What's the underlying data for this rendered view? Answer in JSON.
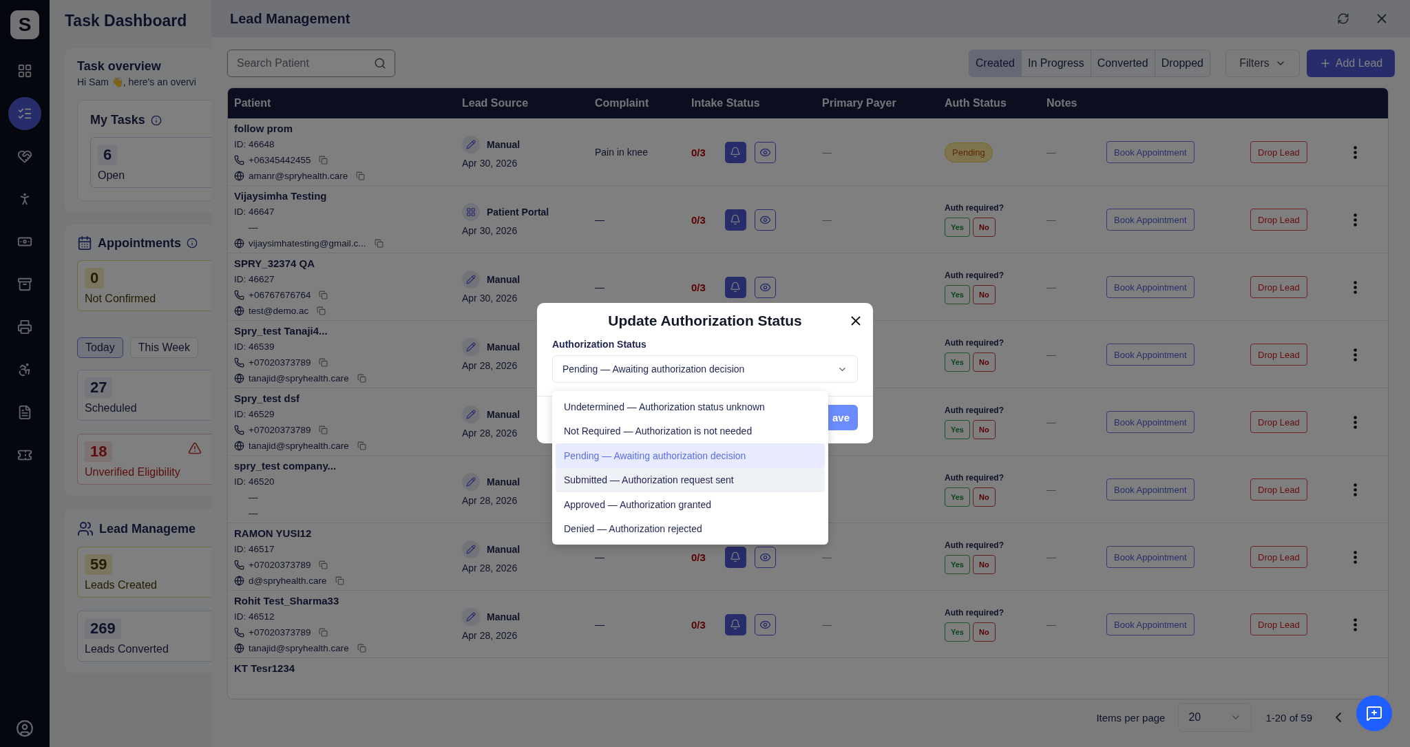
{
  "nav": {
    "logo": "S",
    "items": [
      {
        "selected": false
      },
      {
        "selected": true
      },
      {
        "selected": false
      },
      {
        "selected": false
      },
      {
        "selected": false
      },
      {
        "selected": false
      },
      {
        "selected": false
      },
      {
        "selected": false
      },
      {
        "selected": false
      },
      {
        "selected": false
      }
    ]
  },
  "dashboard": {
    "title": "Task Dashboard",
    "overview": {
      "title": "Task overview",
      "greeting": "Hi Sam 👋, here's an overvi",
      "my_tasks": {
        "title": "My Tasks",
        "stats": [
          {
            "value": "6",
            "label": "Open",
            "kind": "neutral"
          }
        ]
      }
    },
    "appointments": {
      "title": "Appointments",
      "top_stats": [
        {
          "value": "0",
          "label": "Not Confirmed",
          "kind": "warning"
        }
      ],
      "periods": [
        {
          "label": "Today",
          "selected": true
        },
        {
          "label": "This Week",
          "selected": false
        }
      ],
      "stats": [
        {
          "value": "27",
          "label": "Scheduled",
          "kind": "neutral"
        },
        {
          "value": "18",
          "label": "Unverified Eligibility",
          "kind": "alert"
        }
      ]
    },
    "leads": {
      "title": "Lead Manageme",
      "stats": [
        {
          "value": "59",
          "label": "Leads Created",
          "kind": "warning"
        },
        {
          "value": "269",
          "label": "Leads Converted",
          "kind": "neutral"
        }
      ]
    }
  },
  "drawer": {
    "title": "Lead Management",
    "search": {
      "placeholder": "Search Patient"
    },
    "tabs": [
      {
        "label": "Created",
        "selected": true
      },
      {
        "label": "In Progress",
        "selected": false
      },
      {
        "label": "Converted",
        "selected": false
      },
      {
        "label": "Dropped",
        "selected": false
      }
    ],
    "filters": "Filters",
    "add_button": "Add Lead",
    "table": {
      "columns": [
        "Patient",
        "Lead Source",
        "Complaint",
        "Intake Status",
        "Primary Payer",
        "Auth Status",
        "Notes"
      ],
      "rows": [
        {
          "name": "follow prom",
          "id": "ID: 46648",
          "phone": {
            "kind": "phone",
            "value": "+06345442455"
          },
          "email": {
            "kind": "email",
            "value": "amanr@spryhealth.care"
          },
          "source": {
            "kind": "manual",
            "label": "Manual"
          },
          "date": "Apr 30, 2026",
          "complaint": "Pain in knee",
          "intake": "0/3",
          "payer": "—",
          "auth": {
            "kind": "badge",
            "label": "Pending"
          },
          "notes": "—",
          "book": "Book Appointment",
          "drop": "Drop Lead"
        },
        {
          "name": "Vijaysimha Testing",
          "id": "ID: 46647",
          "phone": {
            "kind": "empty",
            "value": "—"
          },
          "email": {
            "kind": "email",
            "value": "vijaysimhatesting@gmail.c..."
          },
          "source": {
            "kind": "portal",
            "label": "Patient Portal"
          },
          "date": "Apr 30, 2026",
          "complaint": "—",
          "intake": "0/3",
          "payer": "—",
          "auth": {
            "kind": "question",
            "prompt": "Auth required?",
            "yes": "Yes",
            "no": "No"
          },
          "notes": "—",
          "book": "Book Appointment",
          "drop": "Drop Lead"
        },
        {
          "name": "SPRY_32374 QA",
          "id": "ID: 46627",
          "phone": {
            "kind": "phone",
            "value": "+06767676764"
          },
          "email": {
            "kind": "email",
            "value": "test@demo.ac"
          },
          "source": {
            "kind": "manual",
            "label": "Manual"
          },
          "date": "Apr 30, 2026",
          "complaint": "—",
          "intake": "0/3",
          "auth": {
            "kind": "question",
            "prompt": "Auth required?",
            "yes": "Yes",
            "no": "No"
          },
          "notes": "—",
          "book": "Book Appointment",
          "drop": "Drop Lead"
        },
        {
          "name": "Spry_test Tanaji4...",
          "id": "ID: 46539",
          "phone": {
            "kind": "phone",
            "value": "+07020373789"
          },
          "email": {
            "kind": "email",
            "value": "tanajid@spryhealth.care"
          },
          "source": {
            "kind": "manual",
            "label": "Manual"
          },
          "date": "Apr 28, 2026",
          "auth": {
            "kind": "question",
            "prompt": "Auth required?",
            "yes": "Yes",
            "no": "No"
          },
          "notes": "—",
          "book": "Book Appointment",
          "drop": "Drop Lead"
        },
        {
          "name": "Spry_test dsf",
          "id": "ID: 46529",
          "phone": {
            "kind": "phone",
            "value": "+07020373789"
          },
          "email": {
            "kind": "email",
            "value": "tanajid@spryhealth.care"
          },
          "source": {
            "kind": "manual",
            "label": "Manual"
          },
          "date": "Apr 28, 2026",
          "auth": {
            "kind": "question",
            "prompt": "Auth required?",
            "yes": "Yes",
            "no": "No"
          },
          "notes": "—",
          "book": "Book Appointment",
          "drop": "Drop Lead"
        },
        {
          "name": "spry_test company...",
          "id": "ID: 46520",
          "phone": {
            "kind": "empty",
            "value": "—"
          },
          "email": {
            "kind": "empty",
            "value": "—"
          },
          "source": {
            "kind": "manual",
            "label": "Manual"
          },
          "date": "Apr 28, 2026",
          "auth": {
            "kind": "question",
            "prompt": "Auth required?",
            "yes": "Yes",
            "no": "No"
          },
          "notes": "—",
          "book": "Book Appointment",
          "drop": "Drop Lead"
        },
        {
          "name": "RAMON YUSI12",
          "id": "ID: 46517",
          "phone": {
            "kind": "phone",
            "value": "+07020373789"
          },
          "email": {
            "kind": "email",
            "value": "d@spryhealth.care"
          },
          "source": {
            "kind": "manual",
            "label": "Manual"
          },
          "date": "Apr 28, 2026",
          "complaint": "—",
          "intake": "0/3",
          "payer": "—",
          "auth": {
            "kind": "question",
            "prompt": "Auth required?",
            "yes": "Yes",
            "no": "No"
          },
          "notes": "—",
          "book": "Book Appointment",
          "drop": "Drop Lead"
        },
        {
          "name": "Rohit Test_Sharma33",
          "id": "ID: 46512",
          "phone": {
            "kind": "phone",
            "value": "+07020373789"
          },
          "email": {
            "kind": "email",
            "value": "tanajid@spryhealth.care"
          },
          "source": {
            "kind": "manual",
            "label": "Manual"
          },
          "date": "Apr 28, 2026",
          "complaint": "—",
          "intake": "0/3",
          "payer": "—",
          "auth": {
            "kind": "question",
            "prompt": "Auth required?",
            "yes": "Yes",
            "no": "No"
          },
          "notes": "—",
          "book": "Book Appointment",
          "drop": "Drop Lead"
        },
        {
          "name": "KT Tesr1234"
        }
      ]
    },
    "pagination": {
      "label": "Items per page",
      "page_size": "20",
      "range": "1-20 of 59"
    }
  },
  "modal": {
    "title": "Update Authorization Status",
    "field_label": "Authorization Status",
    "value": "Pending — Awaiting authorization decision",
    "save": "ave",
    "options": [
      {
        "label": "Undetermined — Authorization status unknown",
        "selected": false,
        "hovered": false
      },
      {
        "label": "Not Required — Authorization is not needed",
        "selected": false,
        "hovered": false
      },
      {
        "label": "Pending — Awaiting authorization decision",
        "selected": true,
        "hovered": false
      },
      {
        "label": "Submitted — Authorization request sent",
        "selected": false,
        "hovered": true
      },
      {
        "label": "Approved — Authorization granted",
        "selected": false,
        "hovered": false
      },
      {
        "label": "Denied — Authorization rejected",
        "selected": false,
        "hovered": false
      }
    ]
  }
}
